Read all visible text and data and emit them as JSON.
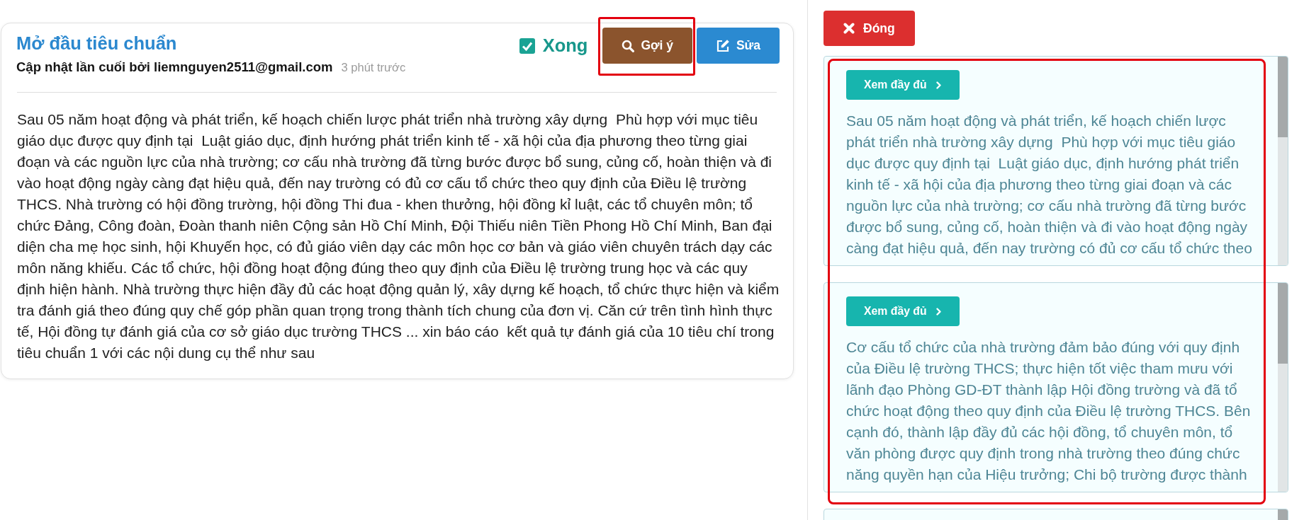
{
  "document": {
    "title": "Mở đầu tiêu chuẩn",
    "updated_by": "Cập nhật lần cuối bởi liemnguyen2511@gmail.com",
    "updated_ago": "3 phút trước",
    "done": {
      "label": "Xong",
      "checked": true
    },
    "buttons": [
      {
        "kind": "hint",
        "label": "Gợi ý",
        "highlighted": true
      },
      {
        "kind": "edit",
        "label": "Sửa",
        "highlighted": false
      }
    ],
    "body": "Sau 05 năm hoạt động và phát triển, kế hoạch chiến lược phát triển nhà trường xây dựng  Phù hợp với mục tiêu giáo dục được quy định tại  Luật giáo dục, định hướng phát triển kinh tế - xã hội của địa phương theo từng giai đoạn và các nguồn lực của nhà trường; cơ cấu nhà trường đã từng bước được bổ sung, củng cố, hoàn thiện và đi vào hoạt động ngày càng đạt hiệu quả, đến nay trường có đủ cơ cấu tổ chức theo quy định của Điều lệ trường THCS. Nhà trường có hội đồng trường, hội đồng Thi đua - khen thưởng, hội đồng kỉ luật, các tổ chuyên môn; tổ chức Đảng, Công đoàn, Đoàn thanh niên Cộng sản Hồ Chí Minh, Đội Thiếu niên Tiền Phong Hồ Chí Minh, Ban đại diện cha mẹ học sinh, hội Khuyến học, có đủ giáo viên dạy các môn học cơ bản và giáo viên chuyên trách dạy các môn năng khiếu. Các tổ chức, hội đồng hoạt động đúng theo quy định của Điều lệ trường trung học và các quy định hiện hành. Nhà trường thực hiện đầy đủ các hoạt động quản lý, xây dựng kế hoạch, tổ chức thực hiện và kiểm tra đánh giá theo đúng quy chế góp phần quan trọng trong thành tích chung của đơn vị. Căn cứ trên tình hình thực tế, Hội đồng tự đánh giá của cơ sở giáo dục trường THCS ... xin báo cáo  kết quả tự đánh giá của 10 tiêu chí trong tiêu chuẩn 1 với các nội dung cụ thể như sau"
  },
  "side_panel": {
    "close_button": "Đóng",
    "highlighted": true,
    "suggestions": [
      {
        "kind": "excerpt",
        "button": "Xem đầy đủ",
        "text": "Sau 05 năm hoạt động và phát triển, kế hoạch chiến lược phát triển nhà trường xây dựng  Phù hợp với mục tiêu giáo dục được quy định tại  Luật giáo dục, định hướng phát triển kinh tế - xã hội của địa phương theo từng giai đoạn và các nguồn lực của nhà trường; cơ cấu nhà trường đã từng bước được bổ sung, củng cố, hoàn thiện và đi vào hoạt động ngày càng đạt hiệu quả, đến nay trường có đủ cơ cấu tổ chức theo"
      },
      {
        "kind": "excerpt",
        "button": "Xem đầy đủ",
        "text": "Cơ cấu tổ chức của nhà trường đảm bảo đúng với quy định của Điều lệ trường THCS; thực hiện tốt việc tham mưu với lãnh đạo Phòng GD-ĐT thành lập Hội đồng trường và đã tổ chức hoạt động theo quy định của Điều lệ trường THCS. Bên cạnh đó, thành lập đầy đủ các hội đồng, tổ chuyên môn, tổ văn phòng được quy định trong nhà trường theo đúng chức năng quyền hạn của Hiệu trưởng; Chi bộ trường được thành"
      },
      {
        "kind": "excerpt"
      }
    ]
  }
}
